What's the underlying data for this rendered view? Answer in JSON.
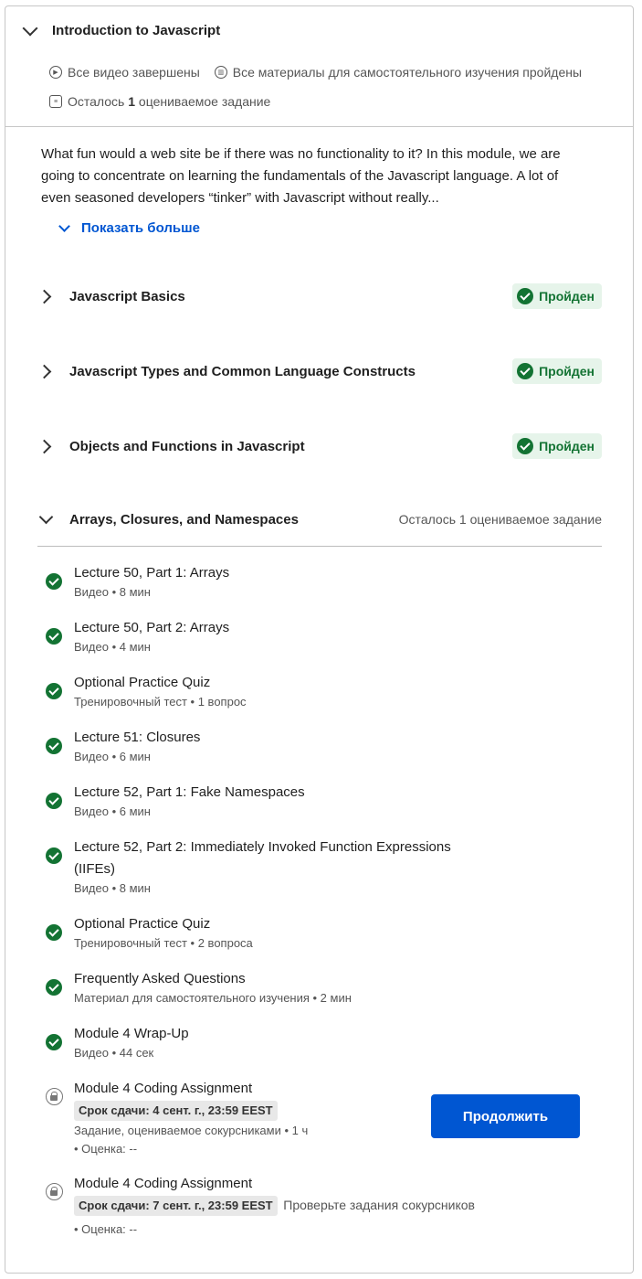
{
  "module": {
    "title": "Introduction to Javascript",
    "all_videos": "Все видео завершены",
    "all_materials": "Все материалы для самостоятельного изучения пройдены",
    "remaining_prefix": "Осталось",
    "remaining_count": "1",
    "remaining_suffix": "оцениваемое задание",
    "description": "What fun would a web site be if there was no functionality to it? In this module, we are going to concentrate on learning the fundamentals of the Javascript language. A lot of even seasoned developers “tinker” with Javascript without really...",
    "show_more": "Показать больше"
  },
  "lessons": [
    {
      "title": "Javascript Basics",
      "status": "Пройден"
    },
    {
      "title": "Javascript Types and Common Language Constructs",
      "status": "Пройден"
    },
    {
      "title": "Objects and Functions in Javascript",
      "status": "Пройден"
    },
    {
      "title": "Arrays, Closures, and Namespaces",
      "remaining": "Осталось 1 оцениваемое задание"
    }
  ],
  "items": [
    {
      "title": "Lecture 50, Part 1: Arrays",
      "sub": "Видео • 8 мин"
    },
    {
      "title": "Lecture 50, Part 2: Arrays",
      "sub": "Видео • 4 мин"
    },
    {
      "title": "Optional Practice Quiz",
      "sub": "Тренировочный тест • 1 вопрос"
    },
    {
      "title": "Lecture 51: Closures",
      "sub": "Видео • 6 мин"
    },
    {
      "title": "Lecture 52, Part 1: Fake Namespaces",
      "sub": "Видео • 6 мин"
    },
    {
      "title": "Lecture 52, Part 2: Immediately Invoked Function Expressions (IIFEs)",
      "sub": "Видео • 8 мин"
    },
    {
      "title": "Optional Practice Quiz",
      "sub": "Тренировочный тест • 2 вопроса"
    },
    {
      "title": "Frequently Asked Questions",
      "sub": "Материал для самостоятельного изучения • 2 мин"
    },
    {
      "title": "Module 4 Wrap-Up",
      "sub": "Видео • 44 сек"
    }
  ],
  "assignments": [
    {
      "title": "Module 4 Coding Assignment",
      "deadline": "Срок сдачи: 4 сент. г., 23:59 EEST",
      "type": "Задание, оцениваемое сокурсниками • 1 ч",
      "grade": "• Оценка: --"
    },
    {
      "title": "Module 4 Coding Assignment",
      "deadline": "Срок сдачи: 7 сент. г., 23:59 EEST",
      "note": "Проверьте задания сокурсников",
      "grade": "• Оценка: --"
    }
  ],
  "continue_button": "Продолжить",
  "colors": {
    "accent": "#0056d2",
    "success": "#137333",
    "success_bg": "#e6f4ea"
  }
}
